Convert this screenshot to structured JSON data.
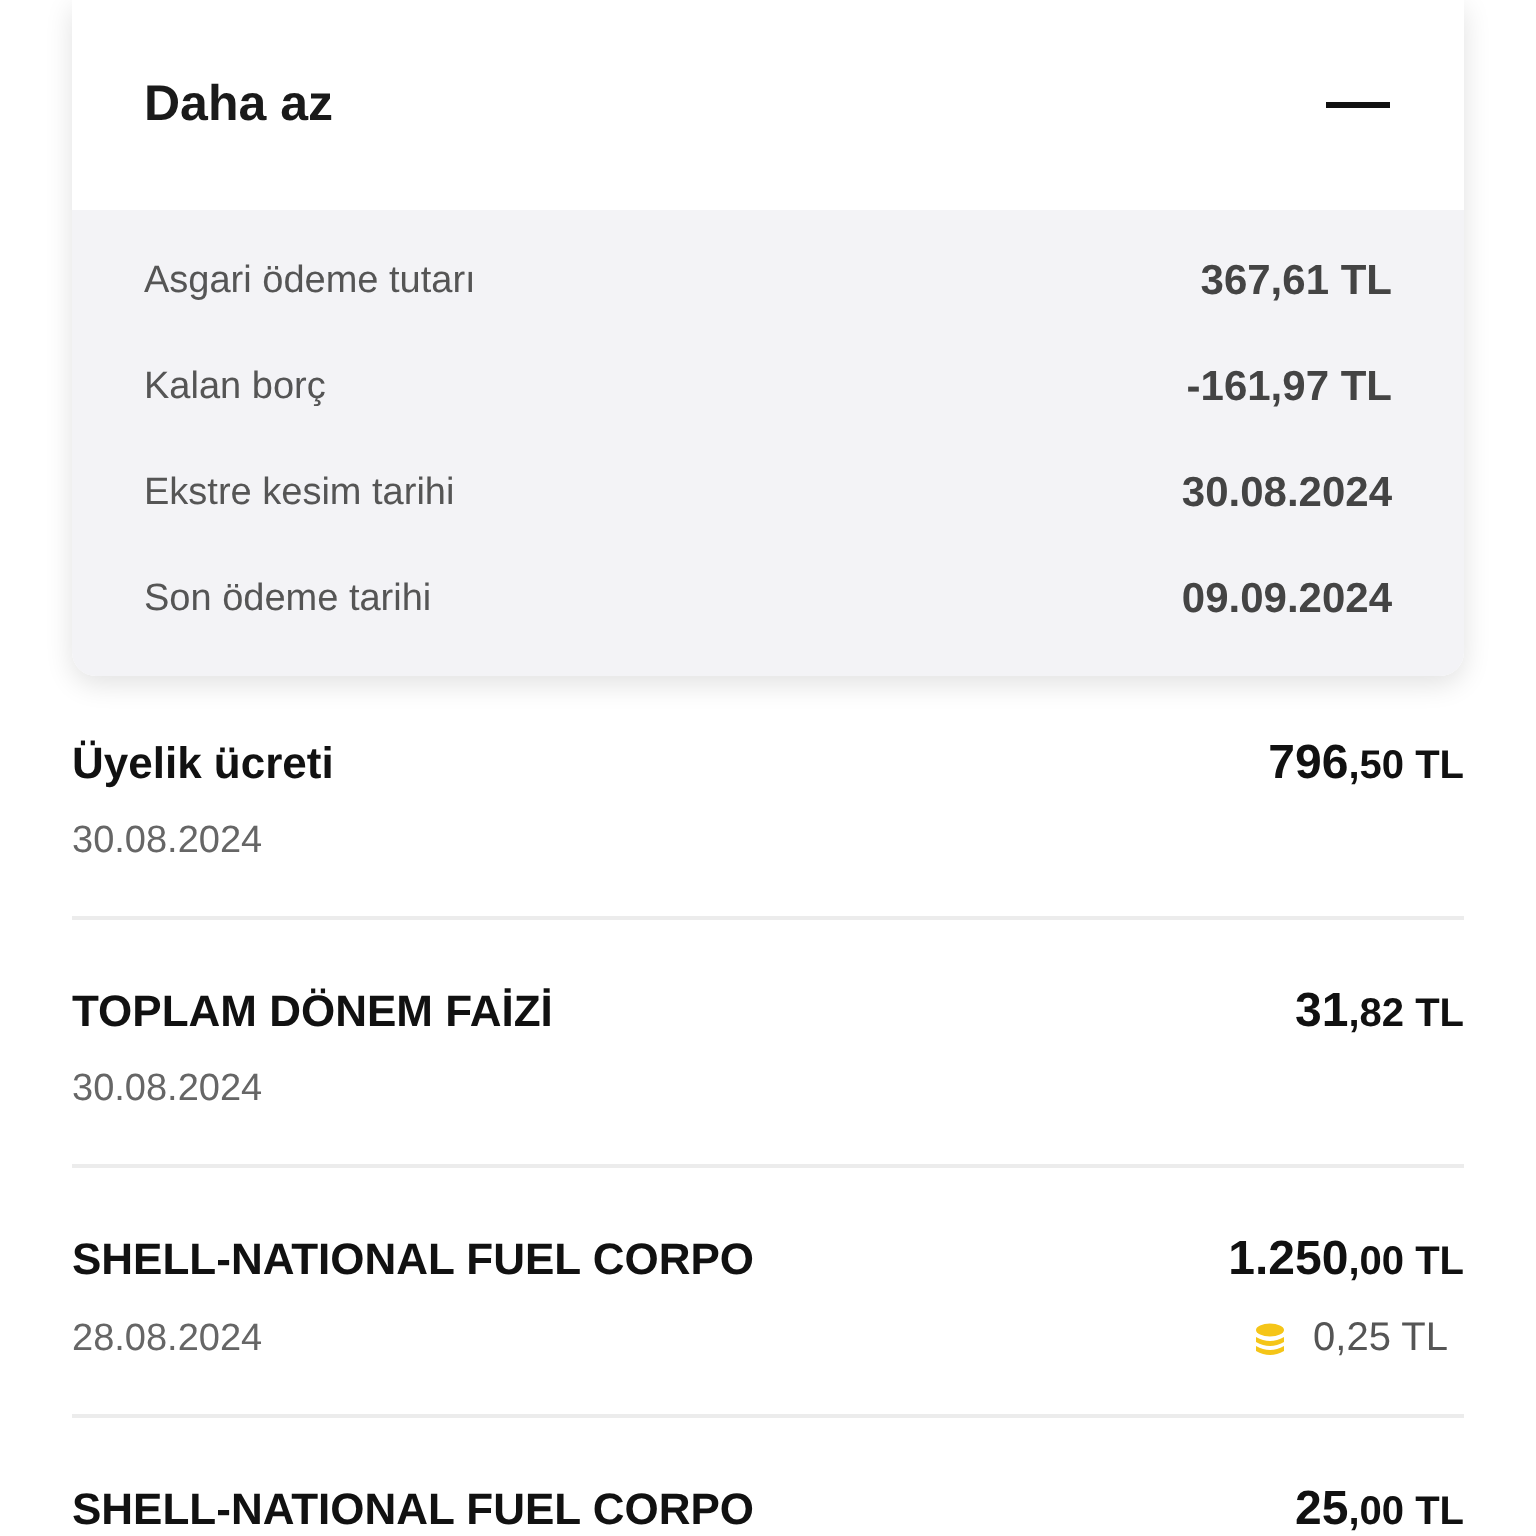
{
  "summary_card": {
    "title": "Daha az",
    "expanded": true,
    "rows": [
      {
        "label": "Asgari ödeme tutarı",
        "value": "367,61 TL"
      },
      {
        "label": "Kalan borç",
        "value": "-161,97 TL"
      },
      {
        "label": "Ekstre kesim tarihi",
        "value": "30.08.2024"
      },
      {
        "label": "Son ödeme tarihi",
        "value": "09.09.2024"
      }
    ]
  },
  "transactions": [
    {
      "title": "Üyelik ücreti",
      "date": "30.08.2024",
      "amount": "796,50 TL"
    },
    {
      "title": "TOPLAM DÖNEM FAİZİ",
      "date": "30.08.2024",
      "amount": "31,82 TL"
    },
    {
      "title": "SHELL-NATIONAL FUEL CORPO",
      "date": "28.08.2024",
      "amount": "1.250,00 TL",
      "points": "0,25 TL"
    },
    {
      "title": "SHELL-NATIONAL FUEL CORPO",
      "amount": "25,00 TL"
    }
  ]
}
